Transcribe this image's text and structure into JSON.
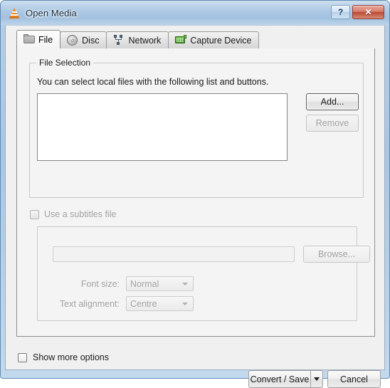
{
  "window": {
    "title": "Open Media",
    "icon": "vlc-cone-icon",
    "help_label": "?",
    "close_label": "✕",
    "frame_color": "#a9c6e2",
    "client_background": "#f0f0f0"
  },
  "tabs": [
    {
      "label": "File",
      "icon": "folder-icon",
      "active": true
    },
    {
      "label": "Disc",
      "icon": "disc-icon",
      "active": false
    },
    {
      "label": "Network",
      "icon": "network-icon",
      "active": false
    },
    {
      "label": "Capture Device",
      "icon": "capture-card-icon",
      "active": false
    }
  ],
  "file_selection": {
    "group_title": "File Selection",
    "description": "You can select local files with the following list and buttons.",
    "list_items": [],
    "add_label": "Add...",
    "remove_label": "Remove",
    "add_enabled": true,
    "remove_enabled": false
  },
  "subtitles": {
    "checkbox_label": "Use a subtitles file",
    "checkbox_checked": false,
    "checkbox_enabled": false,
    "file_value": "",
    "file_placeholder": "",
    "browse_label": "Browse...",
    "font_size_label": "Font size:",
    "font_size_value": "Normal",
    "text_alignment_label": "Text alignment:",
    "text_alignment_value": "Centre"
  },
  "footer": {
    "show_more_label": "Show more options",
    "show_more_checked": false,
    "convert_save_label": "Convert / Save",
    "cancel_label": "Cancel"
  }
}
